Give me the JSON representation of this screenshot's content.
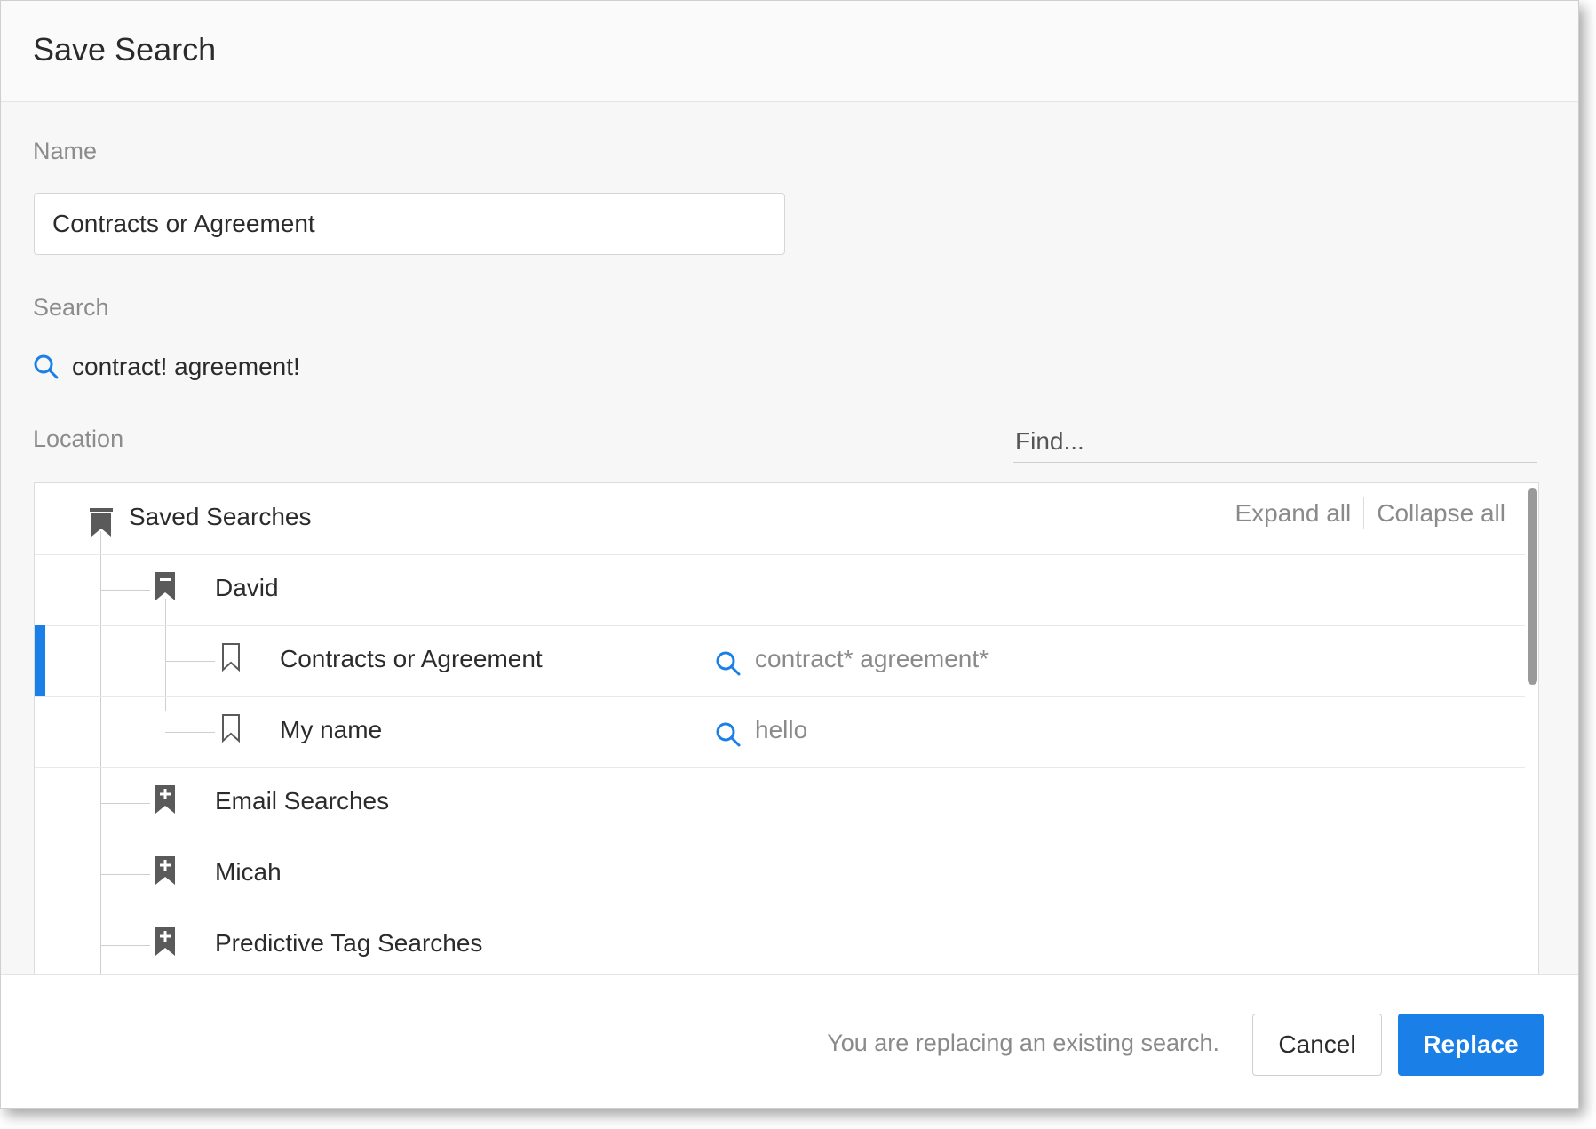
{
  "dialog": {
    "title": "Save Search"
  },
  "form": {
    "name_label": "Name",
    "name_value": "Contracts or Agreement",
    "search_label": "Search",
    "search_query": "contract! agreement!",
    "location_label": "Location",
    "find_placeholder": "Find..."
  },
  "tree": {
    "expand_all": "Expand all",
    "collapse_all": "Collapse all",
    "rows": [
      {
        "label": "Saved Searches",
        "icon": "bookmark-folder-icon",
        "level": 0
      },
      {
        "label": "David",
        "icon": "bookmark-folder-open-icon",
        "level": 1
      },
      {
        "label": "Contracts or Agreement",
        "icon": "bookmark-outline-icon",
        "level": 2,
        "query": "contract* agreement*",
        "selected": true
      },
      {
        "label": "My name",
        "icon": "bookmark-outline-icon",
        "level": 2,
        "query": "hello"
      },
      {
        "label": "Email Searches",
        "icon": "bookmark-folder-plus-icon",
        "level": 1
      },
      {
        "label": "Micah",
        "icon": "bookmark-folder-plus-icon",
        "level": 1
      },
      {
        "label": "Predictive Tag Searches",
        "icon": "bookmark-folder-plus-icon",
        "level": 1
      }
    ]
  },
  "footer": {
    "status": "You are replacing an existing search.",
    "cancel_label": "Cancel",
    "replace_label": "Replace"
  },
  "colors": {
    "accent": "#1a7fe6",
    "icon_gray": "#5a5a5a",
    "muted_text": "#8a8a8a"
  }
}
